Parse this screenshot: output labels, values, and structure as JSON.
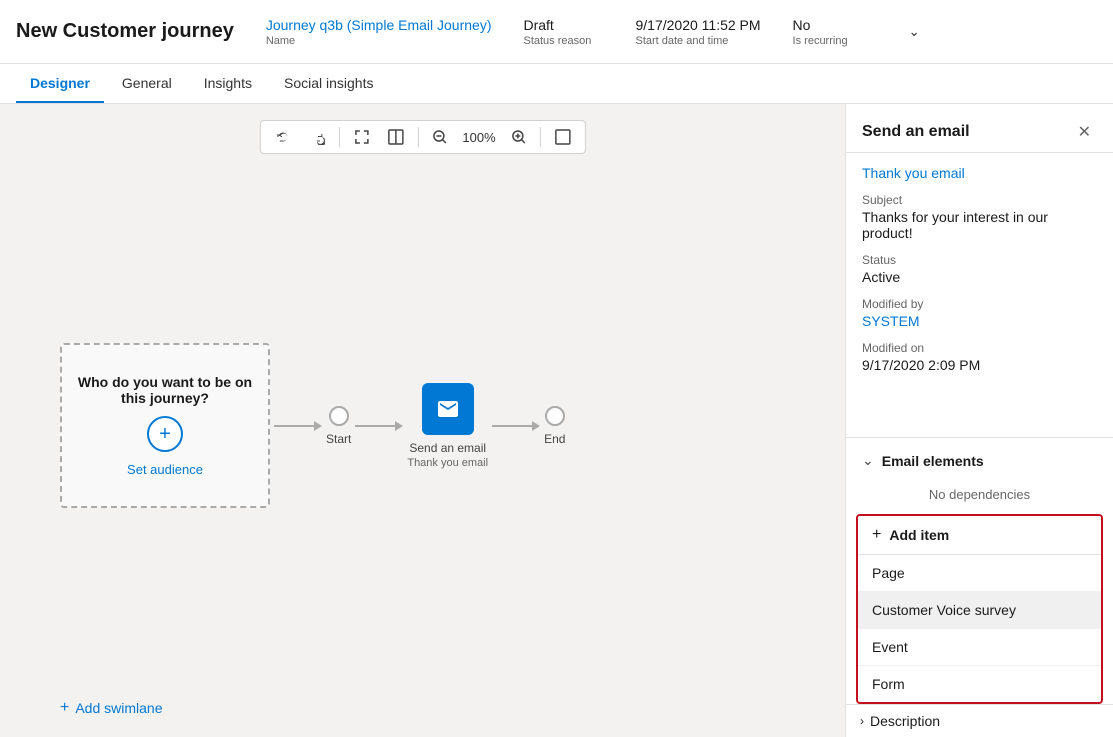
{
  "header": {
    "title": "New Customer journey",
    "journey_name": "Journey q3b (Simple Email Journey)",
    "journey_name_label": "Name",
    "status_reason": "Draft",
    "status_reason_label": "Status reason",
    "start_date": "9/17/2020 11:52 PM",
    "start_date_label": "Start date and time",
    "is_recurring": "No",
    "is_recurring_label": "Is recurring"
  },
  "tabs": [
    {
      "label": "Designer",
      "active": true
    },
    {
      "label": "General",
      "active": false
    },
    {
      "label": "Insights",
      "active": false
    },
    {
      "label": "Social insights",
      "active": false
    }
  ],
  "toolbar": {
    "undo_label": "↩",
    "redo_label": "↪",
    "expand_label": "⤢",
    "split_label": "⊞",
    "zoom_out_label": "🔍",
    "zoom_level": "100%",
    "zoom_in_label": "🔍",
    "fit_label": "▣"
  },
  "canvas": {
    "audience_text": "Who do you want to be on this journey?",
    "set_audience_label": "Set audience",
    "add_swimlane_label": "Add swimlane",
    "nodes": [
      {
        "id": "start",
        "label": "Start"
      },
      {
        "id": "email",
        "label": "Send an email",
        "sublabel": "Thank you email"
      },
      {
        "id": "end",
        "label": "End"
      }
    ]
  },
  "right_panel": {
    "title": "Send an email",
    "close_label": "✕",
    "link_label": "Thank you email",
    "subject_label": "Subject",
    "subject_value": "Thanks for your interest in our product!",
    "status_label": "Status",
    "status_value": "Active",
    "modified_by_label": "Modified by",
    "modified_by_value": "SYSTEM",
    "modified_on_label": "Modified on",
    "modified_on_value": "9/17/2020 2:09 PM",
    "email_elements_label": "Email elements",
    "no_deps_label": "No dependencies",
    "add_item_label": "Add item",
    "dropdown_items": [
      {
        "label": "Page"
      },
      {
        "label": "Customer Voice survey",
        "highlighted": true
      },
      {
        "label": "Event"
      },
      {
        "label": "Form"
      }
    ],
    "description_label": "Description"
  }
}
